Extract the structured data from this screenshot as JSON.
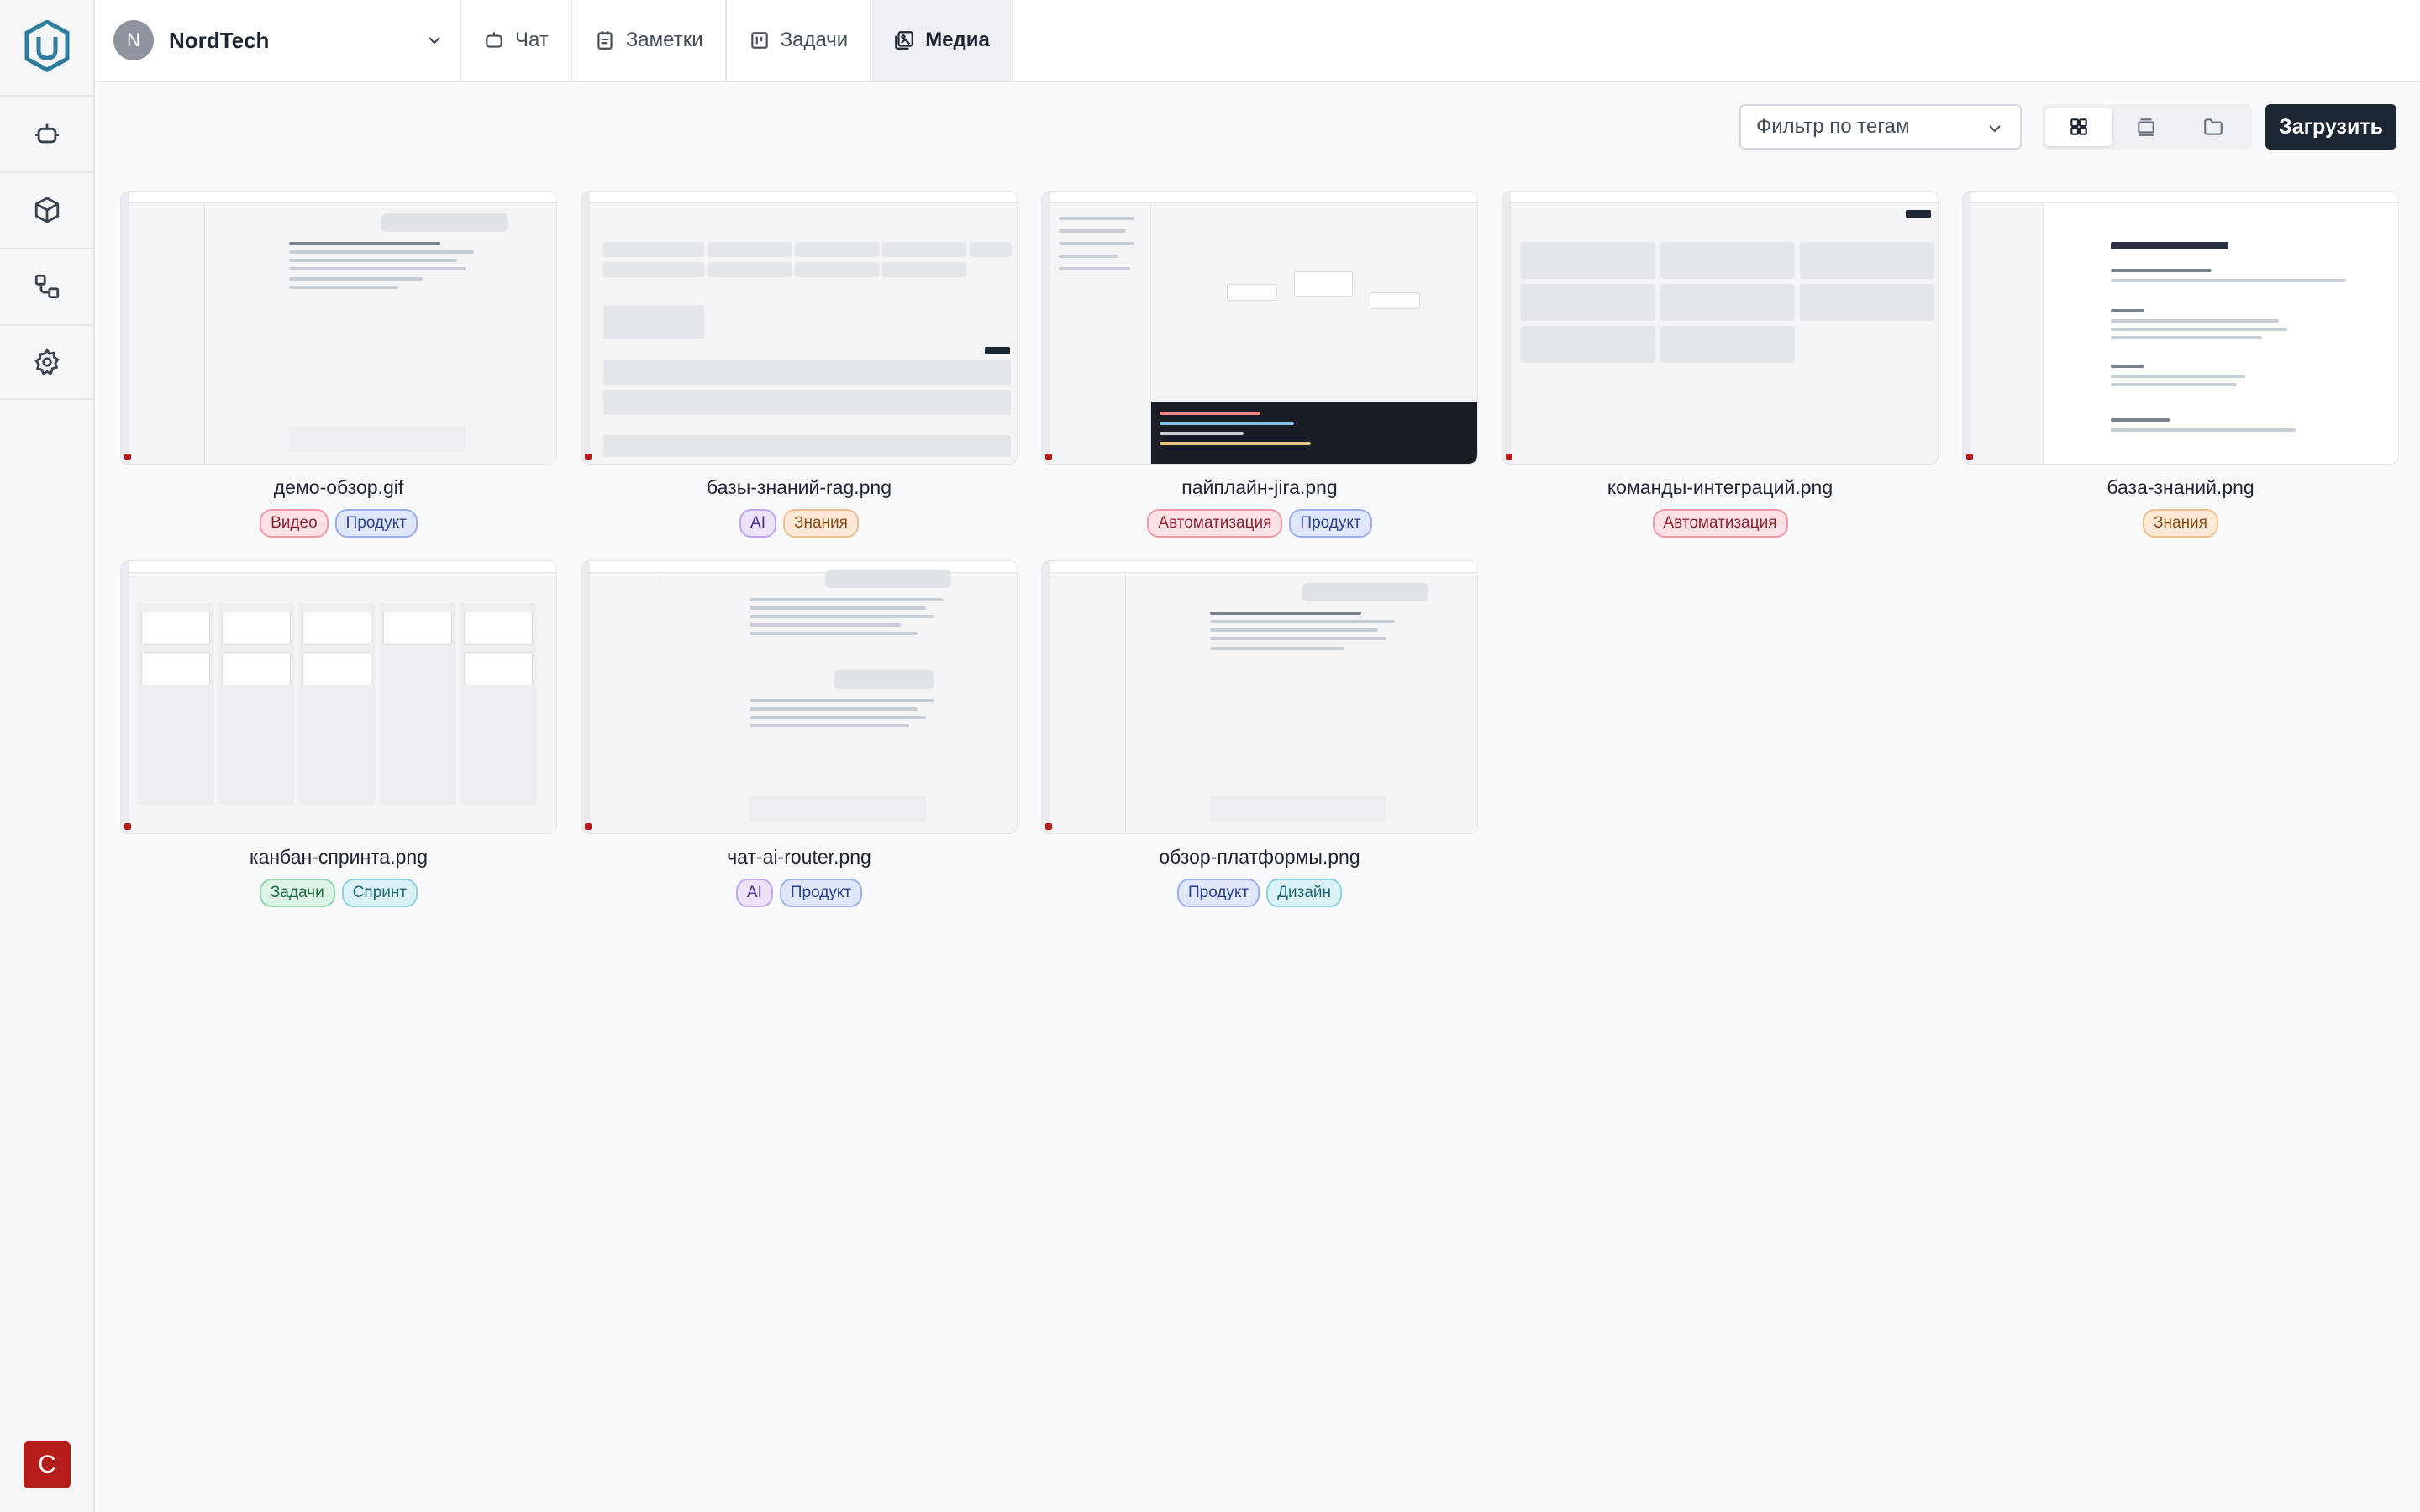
{
  "workspace": {
    "initial": "N",
    "name": "NordTech"
  },
  "tabs": [
    {
      "label": "Чат",
      "icon": "chat-icon"
    },
    {
      "label": "Заметки",
      "icon": "notes-icon"
    },
    {
      "label": "Задачи",
      "icon": "tasks-icon"
    },
    {
      "label": "Медиа",
      "icon": "media-icon",
      "active": true
    }
  ],
  "rail": {
    "items": [
      "bot-icon",
      "cube-icon",
      "workflow-icon",
      "gear-icon"
    ],
    "user_initial": "C"
  },
  "toolbar": {
    "filter_label": "Фильтр по тегам",
    "upload_label": "Загрузить",
    "views": [
      "grid-view-icon",
      "gallery-view-icon",
      "folder-view-icon"
    ]
  },
  "media": [
    {
      "name": "демо-обзор.gif",
      "tags": [
        {
          "label": "Видео",
          "color": "red"
        },
        {
          "label": "Продукт",
          "color": "blue"
        }
      ]
    },
    {
      "name": "базы-знаний-rag.png",
      "tags": [
        {
          "label": "AI",
          "color": "purple"
        },
        {
          "label": "Знания",
          "color": "orange"
        }
      ]
    },
    {
      "name": "пайплайн-jira.png",
      "tags": [
        {
          "label": "Автоматизация",
          "color": "red"
        },
        {
          "label": "Продукт",
          "color": "blue"
        }
      ]
    },
    {
      "name": "команды-интеграций.png",
      "tags": [
        {
          "label": "Автоматизация",
          "color": "red"
        }
      ]
    },
    {
      "name": "база-знаний.png",
      "tags": [
        {
          "label": "Знания",
          "color": "orange"
        }
      ]
    },
    {
      "name": "канбан-спринта.png",
      "tags": [
        {
          "label": "Задачи",
          "color": "green"
        },
        {
          "label": "Спринт",
          "color": "cyan"
        }
      ]
    },
    {
      "name": "чат-ai-router.png",
      "tags": [
        {
          "label": "AI",
          "color": "purple"
        },
        {
          "label": "Продукт",
          "color": "blue"
        }
      ]
    },
    {
      "name": "обзор-платформы.png",
      "tags": [
        {
          "label": "Продукт",
          "color": "blue"
        },
        {
          "label": "Дизайн",
          "color": "cyan"
        }
      ]
    }
  ],
  "colors": {
    "primary_button": "#1d2633",
    "user_avatar": "#b51c1c",
    "active_tab_bg": "#eef0f4"
  }
}
